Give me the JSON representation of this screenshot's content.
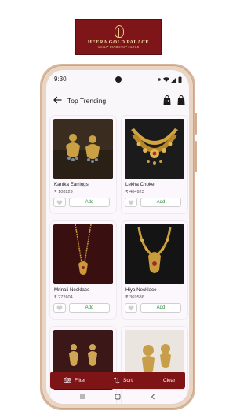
{
  "brand": {
    "name": "HEERA GOLD PALACE",
    "tagline": "GOLD • DIAMOND • SILVER",
    "color": "#7e1518"
  },
  "status_bar": {
    "time": "9:30"
  },
  "header": {
    "title": "Top Trending",
    "icons": [
      "back-arrow-icon",
      "shopping-bag-icon",
      "shopping-bag-icon"
    ]
  },
  "products": [
    {
      "name": "Kanika Earrings",
      "price": "₹ 108229",
      "add_label": "Add"
    },
    {
      "name": "Lekha Choker",
      "price": "₹ 404923",
      "add_label": "Add"
    },
    {
      "name": "Mrinali Necklace",
      "price": "₹ 272604",
      "add_label": "Add"
    },
    {
      "name": "Hiya Necklace",
      "price": "₹ 369586",
      "add_label": "Add"
    },
    {
      "name": "",
      "price": "",
      "add_label": ""
    },
    {
      "name": "",
      "price": "",
      "add_label": ""
    }
  ],
  "bottom_actions": {
    "filter_label": "Filter",
    "sort_label": "Sort",
    "clear_label": "Clear"
  },
  "colors": {
    "accent": "#7f1416",
    "add_text": "#2e8b3c"
  }
}
